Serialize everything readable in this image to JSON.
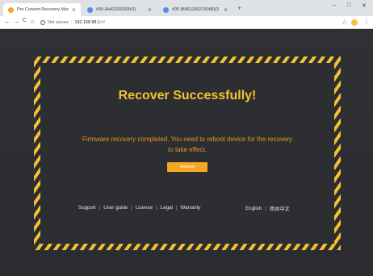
{
  "browser": {
    "tabs": [
      {
        "title": "Pro Convert Recovery Mode",
        "active": true,
        "favicon": "orange-circle-icon"
      },
      {
        "title": "#00 (A462003309/2)",
        "active": false,
        "favicon": "blue-circle-icon"
      },
      {
        "title": "#00 (B461190215088)(3",
        "active": false,
        "favicon": "blue-circle-icon"
      }
    ],
    "new_tab": "+",
    "window_controls": {
      "minimize": "–",
      "maximize": "□",
      "close": "✕"
    },
    "nav": {
      "back": "←",
      "forward": "→",
      "reload": "C",
      "home": "⌂"
    },
    "address": {
      "security": "Not secure",
      "separator": "|",
      "host": "192.168.88.1",
      "path": "/#/"
    },
    "star": "☆",
    "menu": "⋮"
  },
  "page": {
    "headline": "Recover Successfully!",
    "message": "Firmware recovery completed. You need to reboot device for the recovery to take effect.",
    "reboot_label": "Reboot",
    "links": [
      "Support",
      "User guide",
      "License",
      "Legal",
      "Warranty"
    ],
    "languages": [
      "English",
      "简体中文"
    ],
    "separator": "|",
    "colors": {
      "stripe": "#f6c131",
      "headline": "#f6c131",
      "message": "#e8951f",
      "button": "#f5a623",
      "background": "#2c2e31"
    }
  }
}
